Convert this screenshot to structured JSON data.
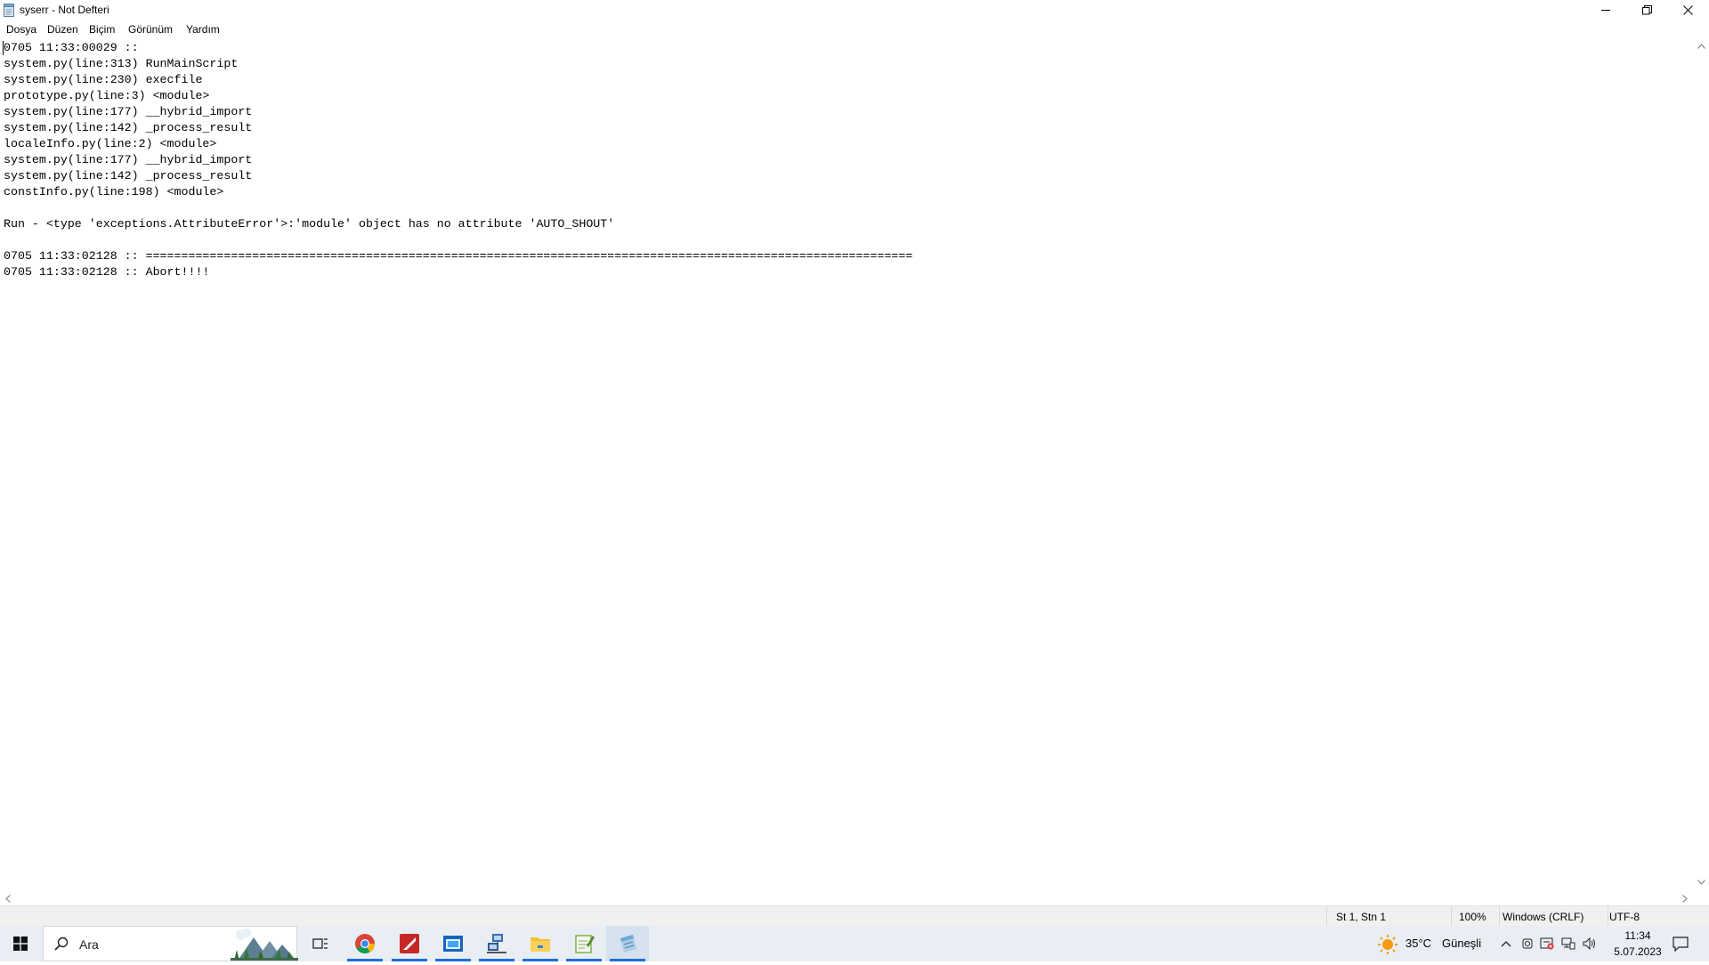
{
  "window": {
    "title": "syserr - Not Defteri"
  },
  "menu": {
    "items": [
      "Dosya",
      "Düzen",
      "Biçim",
      "Görünüm",
      "Yardım"
    ]
  },
  "editor": {
    "content": "0705 11:33:00029 :: \nsystem.py(line:313) RunMainScript\nsystem.py(line:230) execfile\nprototype.py(line:3) <module>\nsystem.py(line:177) __hybrid_import\nsystem.py(line:142) _process_result\nlocaleInfo.py(line:2) <module>\nsystem.py(line:177) __hybrid_import\nsystem.py(line:142) _process_result\nconstInfo.py(line:198) <module>\n\nRun - <type 'exceptions.AttributeError'>:'module' object has no attribute 'AUTO_SHOUT'\n\n0705 11:33:02128 :: ============================================================================================================\n0705 11:33:02128 :: Abort!!!!"
  },
  "status": {
    "position": "St 1, Stn 1",
    "zoom": "100%",
    "line_ending": "Windows (CRLF)",
    "encoding": "UTF-8"
  },
  "taskbar": {
    "search_label": "Ara",
    "apps": [
      {
        "name": "task-view",
        "icon": "task-view-icon"
      },
      {
        "name": "chrome",
        "icon": "chrome-icon",
        "color": "#db4437"
      },
      {
        "name": "red-app",
        "icon": "red-app-icon",
        "color": "#c62828"
      },
      {
        "name": "blue-window-app",
        "icon": "blue-window-icon",
        "color": "#1565c0"
      },
      {
        "name": "network-app",
        "icon": "network-icon",
        "color": "#3a6fb0"
      },
      {
        "name": "file-explorer",
        "icon": "folder-icon",
        "color": "#f2c230"
      },
      {
        "name": "notepad-plus",
        "icon": "notepad-plus-icon",
        "color": "#7cb342"
      },
      {
        "name": "notepad",
        "icon": "notepad-icon",
        "color": "#6aa9d8"
      }
    ],
    "weather_temp": "35°C",
    "weather_text": "Güneşli",
    "time": "11:34",
    "date": "5.07.2023"
  },
  "colors": {
    "taskbar_bg": "#e9eef4",
    "active_indicator": "#1e6fd9",
    "status_bg": "#f0f0f0"
  }
}
